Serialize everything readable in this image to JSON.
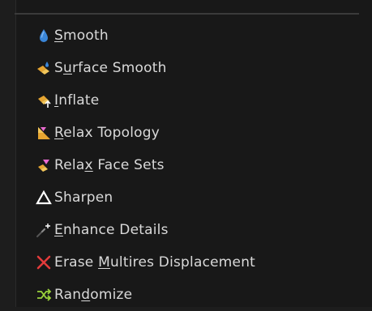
{
  "menu": {
    "items": [
      {
        "pre": "",
        "ul": "S",
        "post": "mooth",
        "icon": "drop-icon"
      },
      {
        "pre": "S",
        "ul": "u",
        "post": "rface Smooth",
        "icon": "surface-smooth-icon"
      },
      {
        "pre": "",
        "ul": "I",
        "post": "nflate",
        "icon": "inflate-icon"
      },
      {
        "pre": "",
        "ul": "R",
        "post": "elax Topology",
        "icon": "relax-topology-icon"
      },
      {
        "pre": "Rela",
        "ul": "x",
        "post": " Face Sets",
        "icon": "relax-face-sets-icon"
      },
      {
        "pre": "Sharpen",
        "ul": "",
        "post": "",
        "icon": "sharpen-icon"
      },
      {
        "pre": "",
        "ul": "E",
        "post": "nhance Details",
        "icon": "enhance-details-icon"
      },
      {
        "pre": "Erase ",
        "ul": "M",
        "post": "ultires Displacement",
        "icon": "erase-icon"
      },
      {
        "pre": "Ran",
        "ul": "d",
        "post": "omize",
        "icon": "randomize-icon"
      }
    ]
  }
}
